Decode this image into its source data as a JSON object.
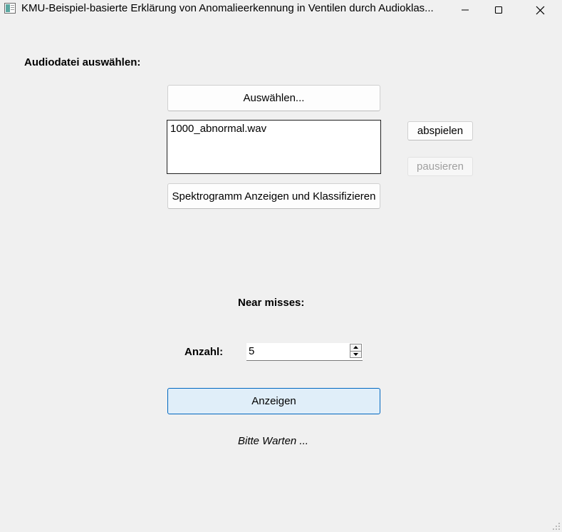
{
  "window": {
    "title": "KMU-Beispiel-basierte Erklärung von Anomalieerkennung in Ventilen durch Audioklas...",
    "icon": "app-window-icon",
    "controls": [
      "minimize-icon",
      "maximize-icon",
      "close-icon"
    ]
  },
  "audio_section": {
    "label": "Audiodatei auswählen:",
    "select_button": "Auswählen...",
    "files": [
      "1000_abnormal.wav"
    ],
    "play_button": "abspielen",
    "pause_button": "pausieren",
    "classify_button": "Spektrogramm Anzeigen und Klassifizieren"
  },
  "near_misses": {
    "heading": "Near misses:",
    "count_label": "Anzahl:",
    "count_value": "5",
    "show_button": "Anzeigen",
    "status": "Bitte Warten ..."
  }
}
